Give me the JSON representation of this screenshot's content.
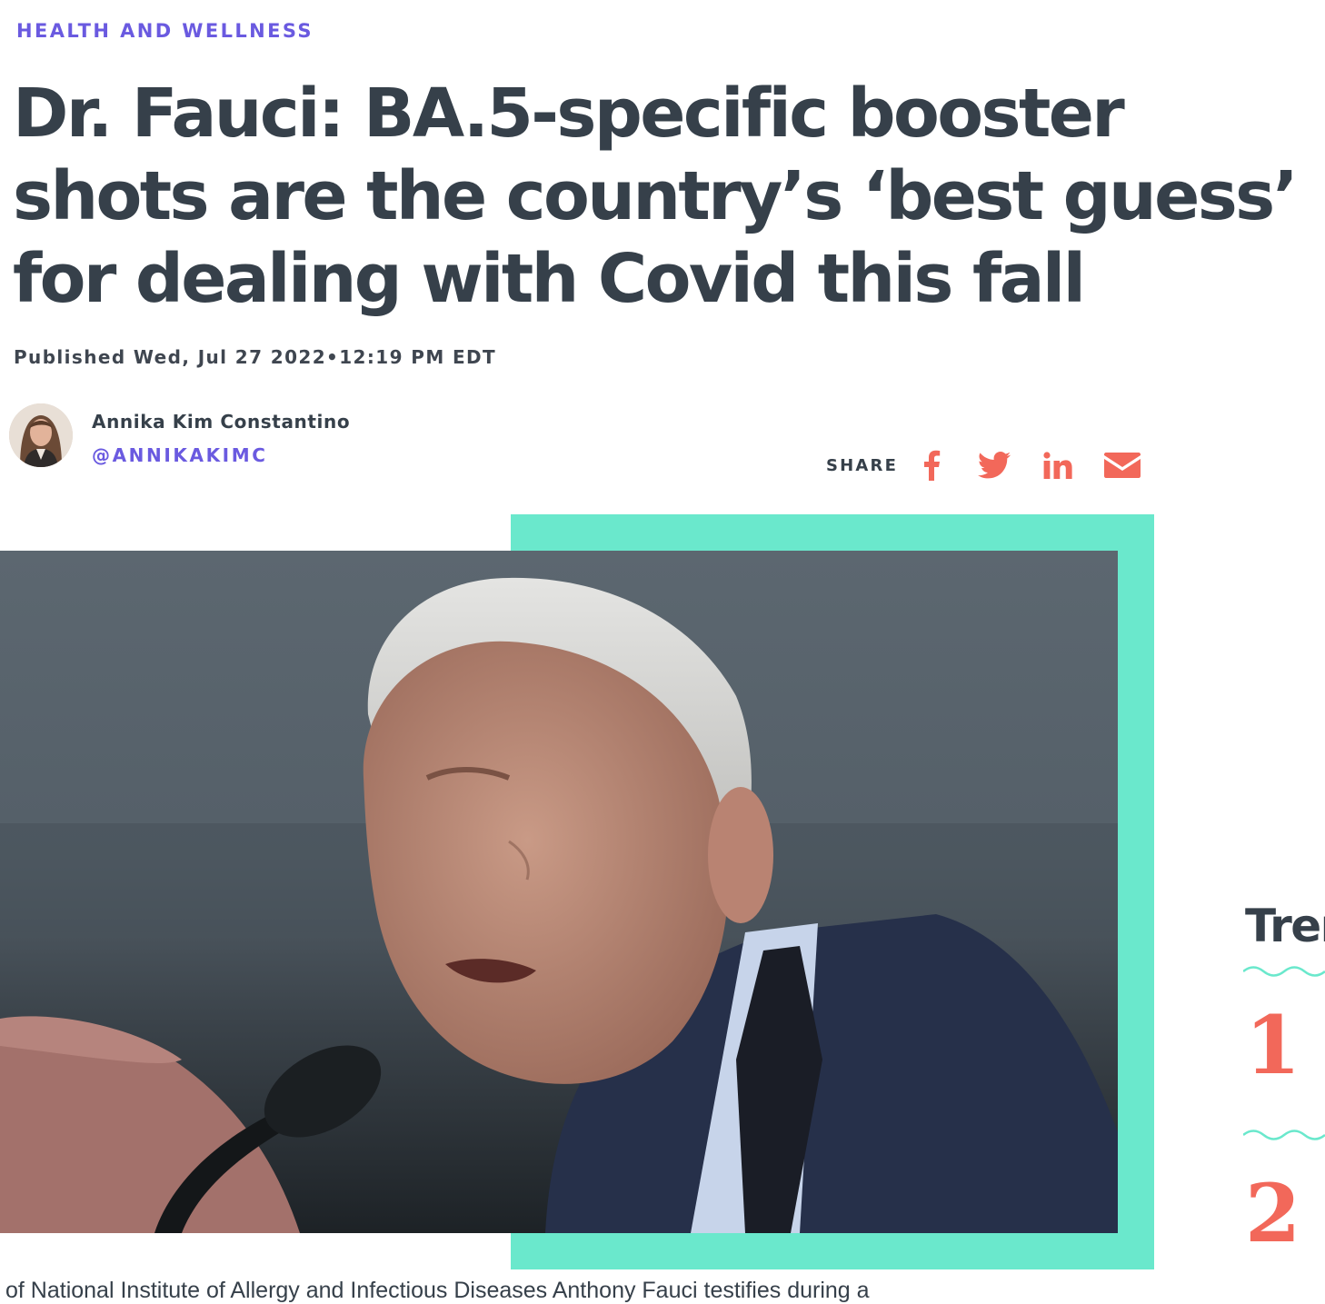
{
  "article": {
    "category": "HEALTH AND WELLNESS",
    "headline": "Dr. Fauci: BA.5-specific booster shots are the country’s ‘best guess’ for dealing with Covid this fall",
    "published": "Published Wed, Jul 27 2022•12:19 PM EDT",
    "author": {
      "name": "Annika Kim Constantino",
      "handle": "@ANNIKAKIMC"
    },
    "caption": "of National Institute of Allergy and Infectious Diseases Anthony Fauci testifies during a"
  },
  "share": {
    "label": "SHARE",
    "buttons": [
      {
        "icon": "facebook-icon"
      },
      {
        "icon": "twitter-icon"
      },
      {
        "icon": "linkedin-icon"
      },
      {
        "icon": "email-icon"
      }
    ]
  },
  "trending": {
    "title": "Trending Now",
    "ranks": [
      "1",
      "2"
    ]
  },
  "colors": {
    "category": "#6a5ae0",
    "headline": "#36404a",
    "share_icons": "#f2685a",
    "frame": "#6ae8cc",
    "rank_numbers": "#f2685a"
  }
}
